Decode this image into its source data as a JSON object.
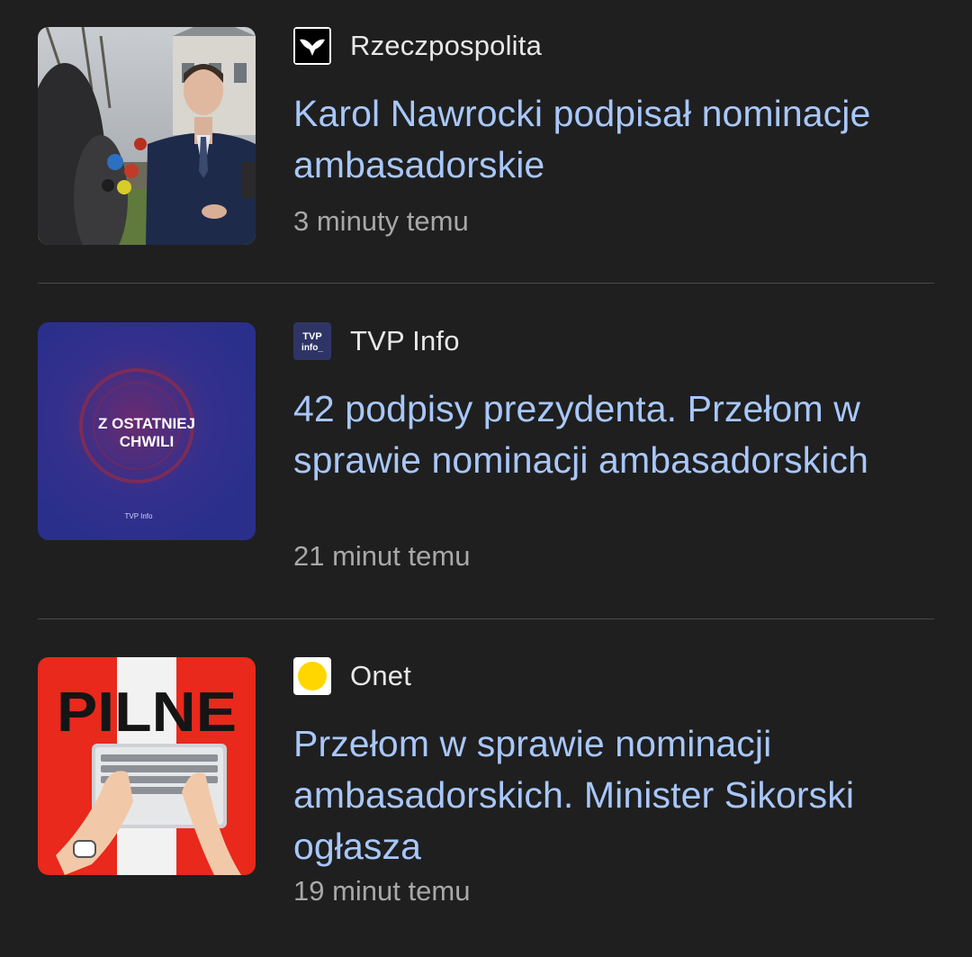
{
  "articles": [
    {
      "source": "Rzeczpospolita",
      "source_icon": "rzeczpospolita-eagle-logo",
      "headline": "Karol Nawrocki podpisał nominacje ambasadorskie",
      "time": "3 minuty temu"
    },
    {
      "source": "TVP Info",
      "source_icon": "tvp-info-logo",
      "headline": "42 podpisy prezydenta. Przełom w sprawie nominacji ambasadorskich",
      "time": "21 minut temu",
      "thumb_text_line1": "Z OSTATNIEJ",
      "thumb_text_line2": "CHWILI",
      "thumb_small": "TVP Info",
      "logo_text_top": "TVP",
      "logo_text_bottom": "info_"
    },
    {
      "source": "Onet",
      "source_icon": "onet-yellow-dot-logo",
      "headline": "Przełom w sprawie nominacji ambasadorskich. Minister Sikorski ogłasza",
      "time": "19 minut temu",
      "thumb_text": "PILNE"
    }
  ],
  "colors": {
    "background": "#1f1f1f",
    "headline": "#a8c7fa",
    "source": "#e8e8e8",
    "time": "#a8a8a8",
    "divider": "#4a4a4a",
    "tvp_blue": "#2a2f8c",
    "onet_red": "#e8291c",
    "onet_yellow": "#ffd600"
  }
}
